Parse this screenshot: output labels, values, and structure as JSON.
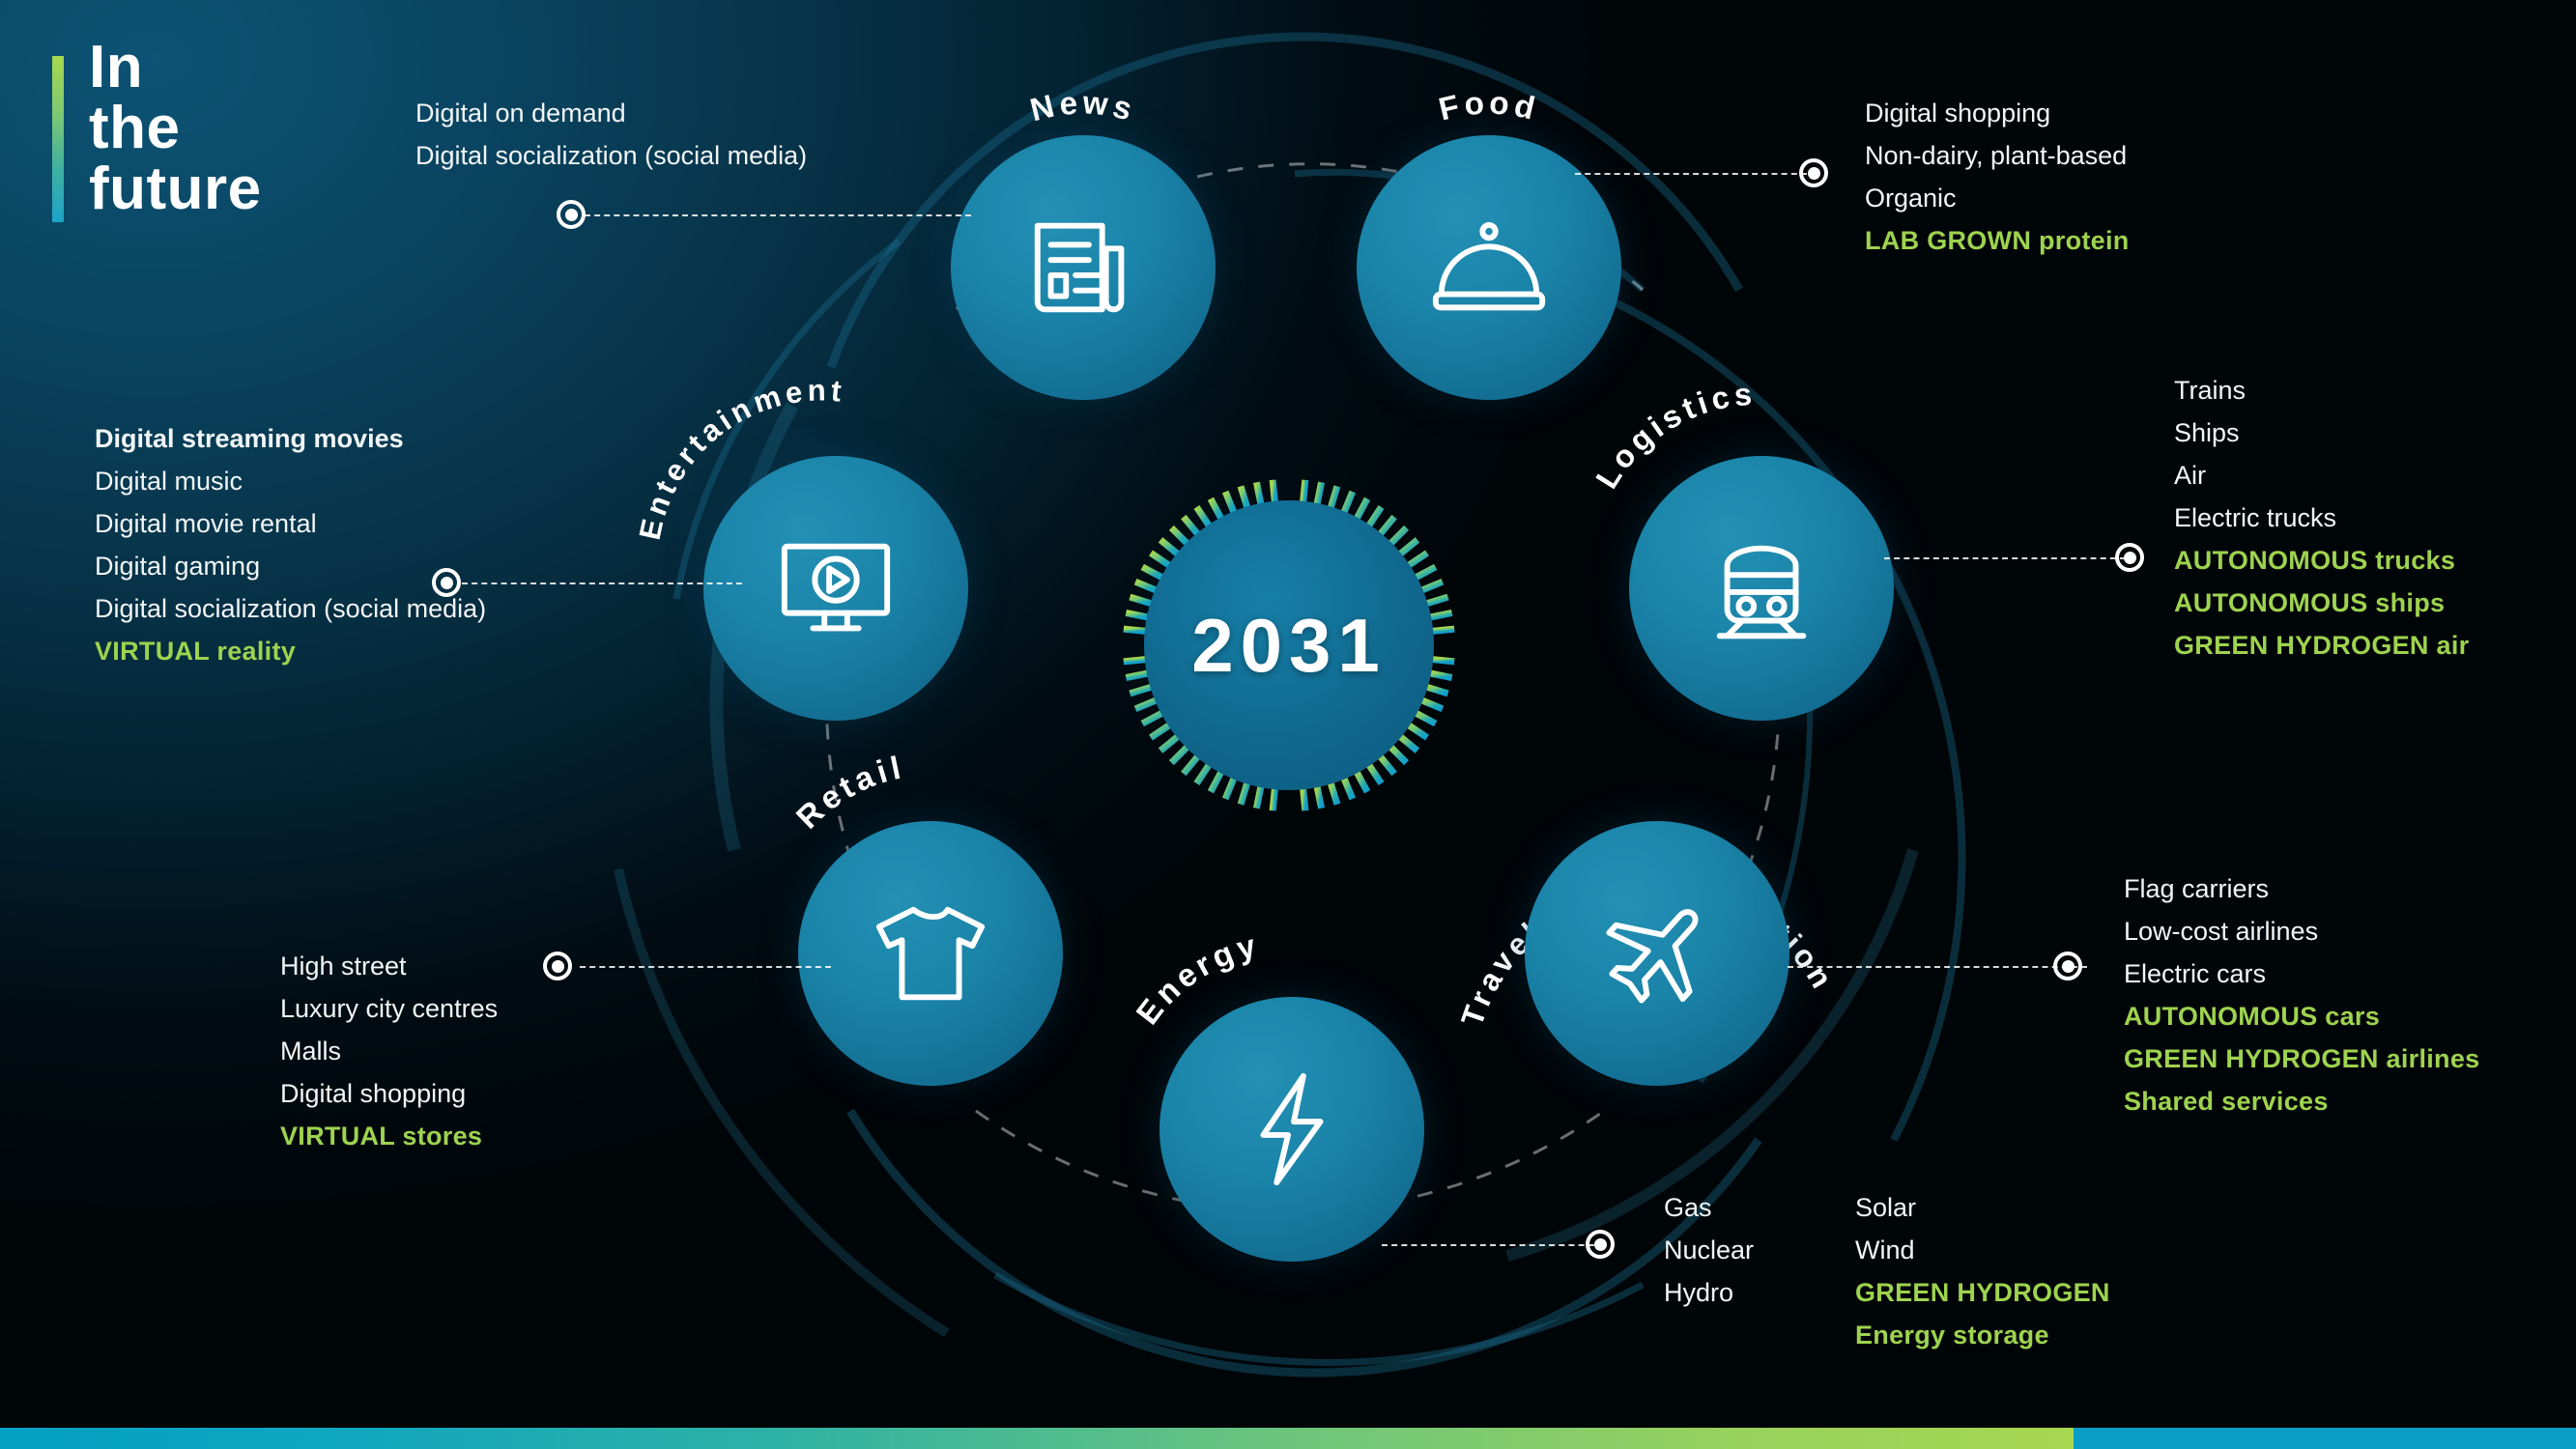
{
  "title": {
    "line1": "In",
    "line2": "the",
    "line3": "future"
  },
  "hub": {
    "year": "2031"
  },
  "colors": {
    "highlight": "#9ED34F",
    "node": "#1a83a8",
    "core": "#10668c"
  },
  "nodes": [
    {
      "id": "news",
      "label": "News",
      "icon": "newspaper-icon"
    },
    {
      "id": "food",
      "label": "Food",
      "icon": "food-cloche-icon"
    },
    {
      "id": "entertainment",
      "label": "Entertainment",
      "icon": "monitor-play-icon"
    },
    {
      "id": "logistics",
      "label": "Logistics",
      "icon": "train-icon"
    },
    {
      "id": "retail",
      "label": "Retail",
      "icon": "t-shirt-icon"
    },
    {
      "id": "travel",
      "label": "Travel & transportation",
      "icon": "airplane-icon"
    },
    {
      "id": "energy",
      "label": "Energy",
      "icon": "lightning-bolt-icon"
    }
  ],
  "lists": {
    "news": [
      {
        "text": "Digital on demand",
        "style": "normal"
      },
      {
        "text": "Digital socialization (social media)",
        "style": "normal"
      }
    ],
    "food": [
      {
        "text": "Digital shopping",
        "style": "normal"
      },
      {
        "text": "Non-dairy, plant-based",
        "style": "normal"
      },
      {
        "text": "Organic",
        "style": "normal"
      },
      {
        "text": "LAB GROWN protein",
        "style": "highlight"
      }
    ],
    "entertainment": [
      {
        "text": "Digital streaming movies",
        "style": "bold"
      },
      {
        "text": "Digital music",
        "style": "normal"
      },
      {
        "text": "Digital movie rental",
        "style": "normal"
      },
      {
        "text": "Digital gaming",
        "style": "normal"
      },
      {
        "text": "Digital socialization (social media)",
        "style": "normal"
      },
      {
        "text": "VIRTUAL reality",
        "style": "highlight"
      }
    ],
    "logistics": [
      {
        "text": "Trains",
        "style": "normal"
      },
      {
        "text": "Ships",
        "style": "normal"
      },
      {
        "text": "Air",
        "style": "normal"
      },
      {
        "text": "Electric trucks",
        "style": "normal"
      },
      {
        "text": "AUTONOMOUS trucks",
        "style": "highlight"
      },
      {
        "text": "AUTONOMOUS ships",
        "style": "highlight"
      },
      {
        "text": "GREEN HYDROGEN air",
        "style": "highlight"
      }
    ],
    "retail": [
      {
        "text": "High street",
        "style": "normal"
      },
      {
        "text": "Luxury city centres",
        "style": "normal"
      },
      {
        "text": "Malls",
        "style": "normal"
      },
      {
        "text": "Digital shopping",
        "style": "normal"
      },
      {
        "text": "VIRTUAL stores",
        "style": "highlight"
      }
    ],
    "travel": [
      {
        "text": "Flag carriers",
        "style": "normal"
      },
      {
        "text": "Low-cost airlines",
        "style": "normal"
      },
      {
        "text": "Electric cars",
        "style": "normal"
      },
      {
        "text": "AUTONOMOUS cars",
        "style": "highlight"
      },
      {
        "text": "GREEN HYDROGEN airlines",
        "style": "highlight"
      },
      {
        "text": "Shared services",
        "style": "highlight"
      }
    ],
    "energy_col1": [
      {
        "text": "Gas",
        "style": "normal"
      },
      {
        "text": "Nuclear",
        "style": "normal"
      },
      {
        "text": "Hydro",
        "style": "normal"
      }
    ],
    "energy_col2": [
      {
        "text": "Solar",
        "style": "normal"
      },
      {
        "text": "Wind",
        "style": "normal"
      },
      {
        "text": "GREEN HYDROGEN",
        "style": "highlight"
      },
      {
        "text": "Energy storage",
        "style": "highlight"
      }
    ]
  }
}
